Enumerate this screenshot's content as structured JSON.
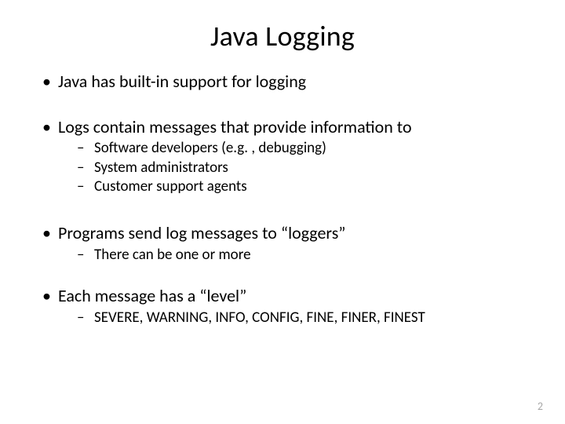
{
  "slide": {
    "title": "Java Logging",
    "bullets": [
      {
        "text": "Java has built-in support for logging",
        "sub": []
      },
      {
        "text": "Logs contain messages that provide information to",
        "sub": [
          "Software developers (e.g. , debugging)",
          "System administrators",
          "Customer support agents"
        ]
      },
      {
        "text": "Programs send log messages to “loggers”",
        "sub": [
          "There can be one or more"
        ]
      },
      {
        "text": "Each message has a “level”",
        "sub": [
          "SEVERE, WARNING, INFO, CONFIG, FINE, FINER, FINEST"
        ]
      }
    ],
    "page_number": "2"
  }
}
